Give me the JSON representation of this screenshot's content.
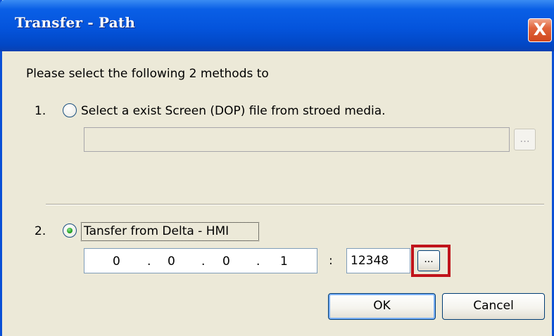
{
  "window": {
    "title": "Transfer - Path",
    "close_label": "X"
  },
  "instructions": "Please select the following 2 methods to",
  "option1": {
    "number": "1.",
    "label": "Select a exist  Screen (DOP) file from stroed media.",
    "selected": false,
    "path_value": "",
    "browse_label": "..."
  },
  "option2": {
    "number": "2.",
    "label": "Tansfer from Delta - HMI",
    "selected": true,
    "ip": [
      "0",
      "0",
      "0",
      "1"
    ],
    "ip_separator": ".",
    "port_separator": ":",
    "port": "12348",
    "browse_label": "..."
  },
  "buttons": {
    "ok": "OK",
    "cancel": "Cancel"
  },
  "colors": {
    "titlebar": "#0454dc",
    "highlight": "#c0141b",
    "dialog_bg": "#ece9d8"
  }
}
